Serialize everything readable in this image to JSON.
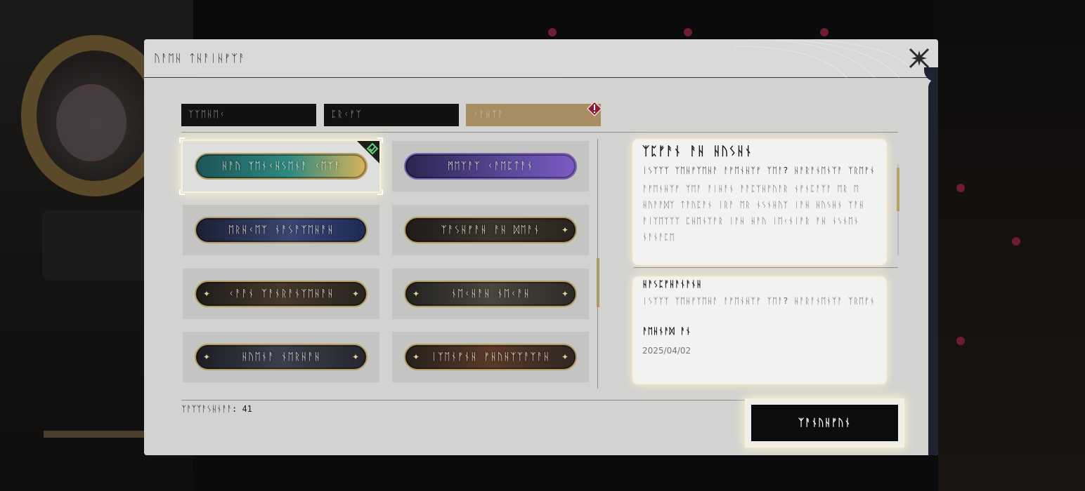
{
  "dialog": {
    "title": "ᚢᚨᛖᚺ ᛏᚺᚨᛁᚺᚠᛉᚨ",
    "close_icon": "close-x-icon"
  },
  "tabs": [
    {
      "label": "ᛉᛉᛖᚺᛖᚲ",
      "active": false
    },
    {
      "label": "ᛈᚱᚲᚠᛉ",
      "active": false
    },
    {
      "label": "ᚲᚨᚺᛉᚨ",
      "active": true,
      "badge": "alert-diamond-icon"
    }
  ],
  "nameplates": [
    {
      "label": "ᚺᚨᚢ ᛉᛖᚾᚲᚺᛊᛖᚾᚨ ᚲᛖᛉᚨ",
      "selected": true,
      "colors": [
        "#1c5457",
        "#2f8a82",
        "#d9b35a"
      ]
    },
    {
      "label": "ᛗᛖᛉᚨᛉ ᚲᚨᛖᛈᛏᚨᚾ",
      "selected": false,
      "colors": [
        "#2a2550",
        "#5b4a9a",
        "#7c5bc2"
      ]
    },
    {
      "label": "ᛖᚱᚺᚲᛖᛉ ᚾᚨᛊᚨᛉᛖᚺᚨᚺ",
      "selected": false,
      "colors": [
        "#1a1f33",
        "#3a4670",
        "#1c2a55"
      ]
    },
    {
      "label": "ᛉᚨᛊᚺᚠᚨᚺ ᚨᚺ ᛞᛖᚨᚾ",
      "selected": false,
      "colors": [
        "#1d1a18",
        "#3b342d",
        "#2a2420"
      ]
    },
    {
      "label": "ᚲᚨᚨᚾ ᛉᚨᚾᚱᚨᚾᛉᛖᚺᚨᚺ",
      "selected": false,
      "colors": [
        "#1e1b18",
        "#45392c",
        "#2a241f"
      ]
    },
    {
      "label": "ᚾᛖᚲᚺᚨᚺ ᚾᛖᚲᚨᚺ",
      "selected": false,
      "colors": [
        "#22211f",
        "#4a463f",
        "#2d2a26"
      ]
    },
    {
      "label": "ᚺᚢᛖᚾᚨ ᚾᛖᚱᚺᚨᚺ",
      "selected": false,
      "colors": [
        "#1c1d22",
        "#3c3f4d",
        "#25262d"
      ]
    },
    {
      "label": "ᛁᛉᛖᚾᚠᚾᚺ ᚠᚺᚢᚺᛉᛉᚨᛉᚨᚺ",
      "selected": false,
      "colors": [
        "#24201c",
        "#5a3a2a",
        "#2e2723"
      ]
    }
  ],
  "detail": {
    "name": "ᛉᛈᚠᚨᚾ ᚨᚺ ᚺᚢᛊᚺᚾ",
    "subtitle": "ᛁᛊᛉᛉᛉ ᛉᛖᚺᚠᛉᛖᚺᚨ ᚨᚠᛖᚾᚺᛉᚠ ᛉᛖᚨ? ᚺᚨᚱᚨᚾᛖᚾᛉᚨ ᛉᚱᛖᚠᚾ",
    "description": "ᚨᚠᛖᚾᚺᛉᚠ ᛉᛖᚨ ᚨᛁᚺᚨᚾ ᚨᚨᛈᛉᚺᚠᚢᚨᚱ ᚾᚠᚾᛈᚨᛉᚨ ᛖᚱ ᛖ ᚺᚢᚨᚨᛞᛉ ᛏᚨᚢᛈᚨᚾ ᛁᚱᚨ ᛖᚱ ᚾᛊᚾᚺᚢᛉ ᛁᚨᚺ ᚺᚢᛊᚺᚾ ᛉᚨᚺ ᚨᛁᛉᛖᛉᛉᛉ ᛈᚺᛖᚾᛉᚨᚱ ᛁᚨᚺ ᚺᚨᚢ ᛁᛖᚲᚾᛁᚨᚱ ᚨᚺ ᚾᛊᚾᛖᚾ ᚾᚨᚾᚨᛈᛖ"
  },
  "acquire": {
    "heading": "ᚺᚨᛊᛈᚠᚺᚨᚾᚨᚾᚺ",
    "text": "ᛁᛊᛉᛉᛉ ᛉᛖᚺᚠᛉᛖᚺᚨ ᚨᚠᛖᚾᚺᛉᚠ ᛉᛖᚨ? ᚺᚨᚱᚨᚾᛖᚾᛉᚨ ᛉᚱᛖᚠᚾ",
    "date_label": "ᚨᛖᚺᚾᚨᛞ ᚨᚾ",
    "date": "2025/04/02"
  },
  "footer": {
    "owned_label": "ᛉᚨᛉᛉᚨᛊᚺᚾᚨᚨ: 41",
    "equip_label": "ᛉᚨᚾᚢᚺᚠᚢᚾ"
  },
  "colors": {
    "accent_gold": "#a88c62",
    "highlight": "#fff6cd",
    "dialog_bg": "#d2d2d0",
    "dark": "#0c0c0c"
  }
}
